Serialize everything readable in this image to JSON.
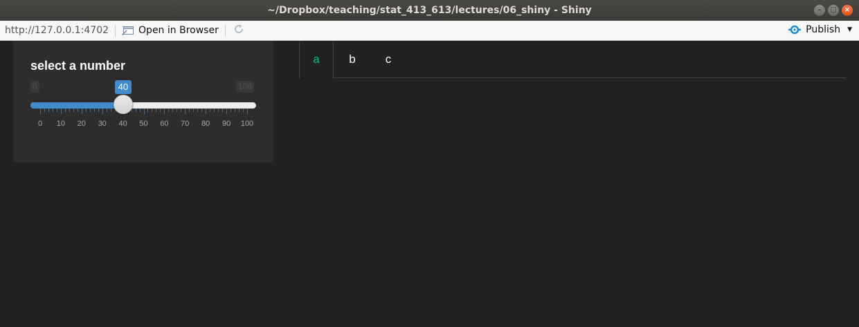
{
  "window": {
    "title": "~/Dropbox/teaching/stat_413_613/lectures/06_shiny - Shiny",
    "minimize_glyph": "–",
    "maximize_glyph": "□",
    "close_glyph": "×"
  },
  "toolbar": {
    "url": "http://127.0.0.1:4702",
    "open_in_browser_label": "Open in Browser",
    "publish_label": "Publish"
  },
  "sidebar": {
    "input_label": "select a number",
    "slider": {
      "min": 0,
      "max": 100,
      "value": 40,
      "min_label": "0",
      "max_label": "100",
      "value_label": "40",
      "tick_labels": [
        "0",
        "10",
        "20",
        "30",
        "40",
        "50",
        "60",
        "70",
        "80",
        "90",
        "100"
      ],
      "fill_color": "#428bca"
    }
  },
  "tabs": [
    {
      "label": "a",
      "active": true
    },
    {
      "label": "b",
      "active": false
    },
    {
      "label": "c",
      "active": false
    }
  ],
  "colors": {
    "background": "#222222",
    "accent": "#00bc8c",
    "well": "#2d2d2d"
  }
}
